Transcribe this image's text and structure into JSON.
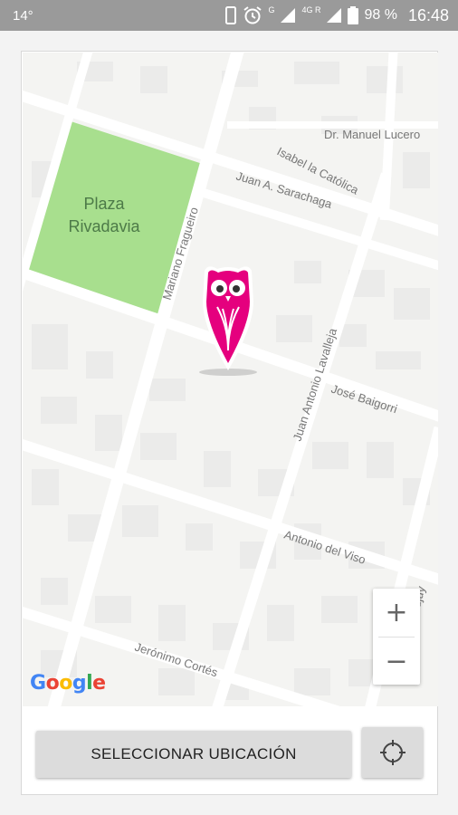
{
  "status_bar": {
    "temperature": "14°",
    "network_g": "G",
    "network_4g": "4G R",
    "battery": "98 %",
    "time": "16:48"
  },
  "map": {
    "park_label_line1": "Plaza",
    "park_label_line2": "Rivadavia",
    "streets": {
      "manuel_lucero": "Dr. Manuel Lucero",
      "isabel": "Isabel la Católica",
      "sarachaga": "Juan A. Sarachaga",
      "fragueiro": "Mariano Fragueiro",
      "lavalleja": "Juan Antonio Lavalleja",
      "baigorri": "José Baigorri",
      "viso": "Antonio del Viso",
      "jujuy": "Jujuy",
      "cortes": "Jerónimo Cortés"
    },
    "zoom_in": "+",
    "zoom_out": "−",
    "attribution_letters": [
      "G",
      "o",
      "o",
      "g",
      "l",
      "e"
    ]
  },
  "colors": {
    "google": [
      "#4285F4",
      "#EA4335",
      "#FBBC05",
      "#4285F4",
      "#34A853",
      "#EA4335"
    ],
    "pin": "#e5007e",
    "park": "#a8df8e"
  },
  "actions": {
    "select_label": "SELECCIONAR UBICACIÓN",
    "locate_icon": "crosshair-icon"
  }
}
